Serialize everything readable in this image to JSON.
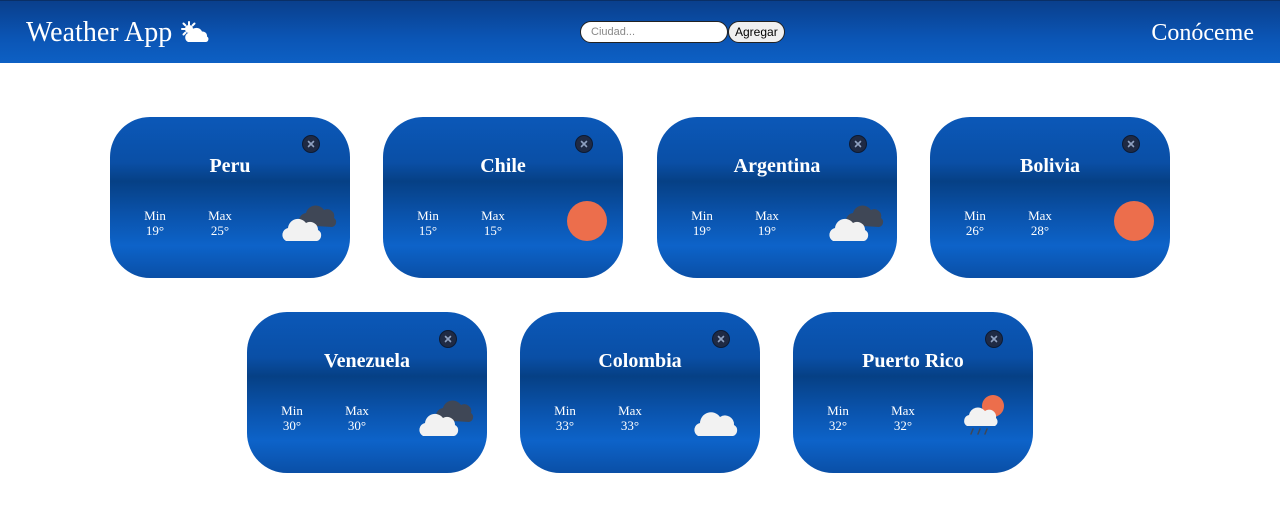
{
  "app": {
    "title": "Weather App",
    "about_label": "Conóceme"
  },
  "search": {
    "placeholder": "Ciudad...",
    "value": "",
    "add_label": "Agregar"
  },
  "cards": [
    {
      "city": "Peru",
      "min_label": "Min",
      "min": "19°",
      "max_label": "Max",
      "max": "25°",
      "icon": "partly-cloudy-dark-icon"
    },
    {
      "city": "Chile",
      "min_label": "Min",
      "min": "15°",
      "max_label": "Max",
      "max": "15°",
      "icon": "sun-icon"
    },
    {
      "city": "Argentina",
      "min_label": "Min",
      "min": "19°",
      "max_label": "Max",
      "max": "19°",
      "icon": "partly-cloudy-dark-icon"
    },
    {
      "city": "Bolivia",
      "min_label": "Min",
      "min": "26°",
      "max_label": "Max",
      "max": "28°",
      "icon": "sun-icon"
    },
    {
      "city": "Venezuela",
      "min_label": "Min",
      "min": "30°",
      "max_label": "Max",
      "max": "30°",
      "icon": "partly-cloudy-dark-icon"
    },
    {
      "city": "Colombia",
      "min_label": "Min",
      "min": "33°",
      "max_label": "Max",
      "max": "33°",
      "icon": "cloud-icon"
    },
    {
      "city": "Puerto Rico",
      "min_label": "Min",
      "min": "32°",
      "max_label": "Max",
      "max": "32°",
      "icon": "rain-sun-icon"
    }
  ],
  "colors": {
    "navbar": "#0b55b5",
    "card": "#0a4fa6",
    "sun": "#ec6e4c",
    "cloud": "#f2f2f2",
    "dark_cloud": "#3f4756",
    "close_button": "#1f2a44"
  }
}
